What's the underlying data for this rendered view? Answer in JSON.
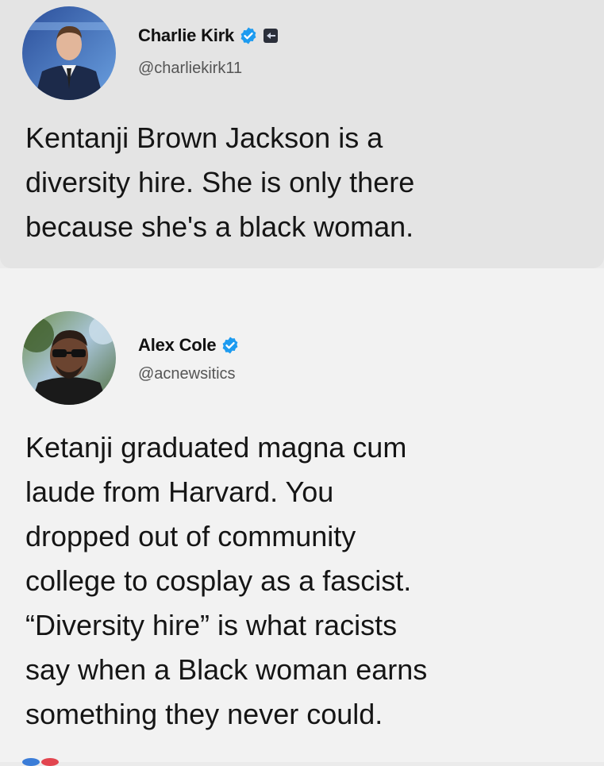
{
  "tweets": [
    {
      "display_name": "Charlie Kirk",
      "handle": "@charliekirk11",
      "verified": true,
      "affiliation_badge": true,
      "avatar_icon": "avatar-photo-man-suit",
      "text": "Kentanji Brown Jackson is a\ndiversity hire. She is only there\nbecause she's a black woman."
    },
    {
      "display_name": "Alex Cole",
      "handle": "@acnewsitics",
      "verified": true,
      "affiliation_badge": false,
      "avatar_icon": "avatar-photo-man-sunglasses",
      "text": "Ketanji graduated magna cum\nlaude from Harvard. You\ndropped out of community\ncollege to cosplay as a fascist.\n“Diversity hire” is what racists\nsay when a Black woman earns\nsomething they never could."
    }
  ],
  "colors": {
    "verified_blue": "#1d9bf0",
    "text": "#151515",
    "handle": "#555555"
  }
}
